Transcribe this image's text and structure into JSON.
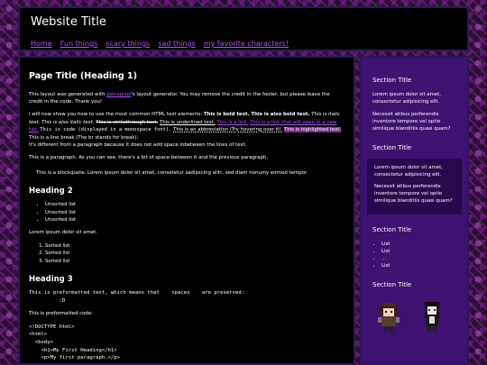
{
  "header": {
    "title": "Website Title",
    "nav": [
      "Home",
      "Fun things",
      "scary things",
      "sad things",
      "my favorite characters!"
    ]
  },
  "main": {
    "page_title": "Page Title (Heading 1)",
    "intro_pre": "This layout was generated with ",
    "intro_link": "petrapixel",
    "intro_post": "'s layout generator. You may remove the credit in the footer, but please leave the credit in the code. Thank you!",
    "elements_intro": "I will now show you how to use the most common HTML text elements: ",
    "bold1": "This is bold text.",
    "bold2": "This is also bold text.",
    "italic1": "This is italic text.",
    "italic2": "This is also italic text.",
    "strike": "This is strikethrough text.",
    "underline": "This is underlined text.",
    "link1": "This is a link.",
    "link2": "This is a link that will open in a new tab.",
    "code": "This is code (displayed in a monospace font).",
    "abbr": "This is an abbreviation (Try hovering over it).",
    "highlight": "This is highlighted text.",
    "linebreak": " This is a line break (The br stands for break):",
    "linebreak2": "It's different from a paragraph because it does not add space inbetween the lines of text.",
    "paragraph": "This is a paragraph. As you can see, there's a bit of space between it and the previous paragraph.",
    "blockquote": "This is a blockquote. Lorem ipsum dolor sit amet, consetetur sadipscing elitr, sed diam nonumy eirmod tempor.",
    "heading2": "Heading 2",
    "unsorted": [
      "Unsorted list",
      "Unsorted list",
      "Unsorted list"
    ],
    "lorem": "Lorem ipsum dolor sit amet.",
    "sorted": [
      "Sorted list",
      "Sorted list",
      "Sorted list"
    ],
    "heading3": "Heading 3",
    "pre1": "This is preformatted text, which means that    spaces    are preserved:\n          :D",
    "pre_code_label": "This is preformatted code:",
    "code_block": "<!DOCTYPE html>\n<html>\n  <body>\n    <h1>My First Heading</h1>\n    <p>My first paragraph.</p>"
  },
  "sidebar": {
    "section_title_1": "Section Title",
    "s1_p1": "Lorem ipsum dolor sit amet, consectetur adipisicing elit.",
    "s1_p2": "Necessit atibus perferendis inventore tempore vel optio similique blanditiis quasi quam?",
    "section_title_2": "Section Title",
    "s2_p1": "Lorem ipsum dolor sit amet, consectetur adipisicing elit.",
    "s2_p2": "Necessit atibus perferendis inventore tempore vel optio similique blanditiis quasi quam?",
    "section_title_3": "Section Title",
    "list": [
      "List",
      "List",
      "...",
      "List"
    ],
    "section_title_4": "Section Title"
  }
}
